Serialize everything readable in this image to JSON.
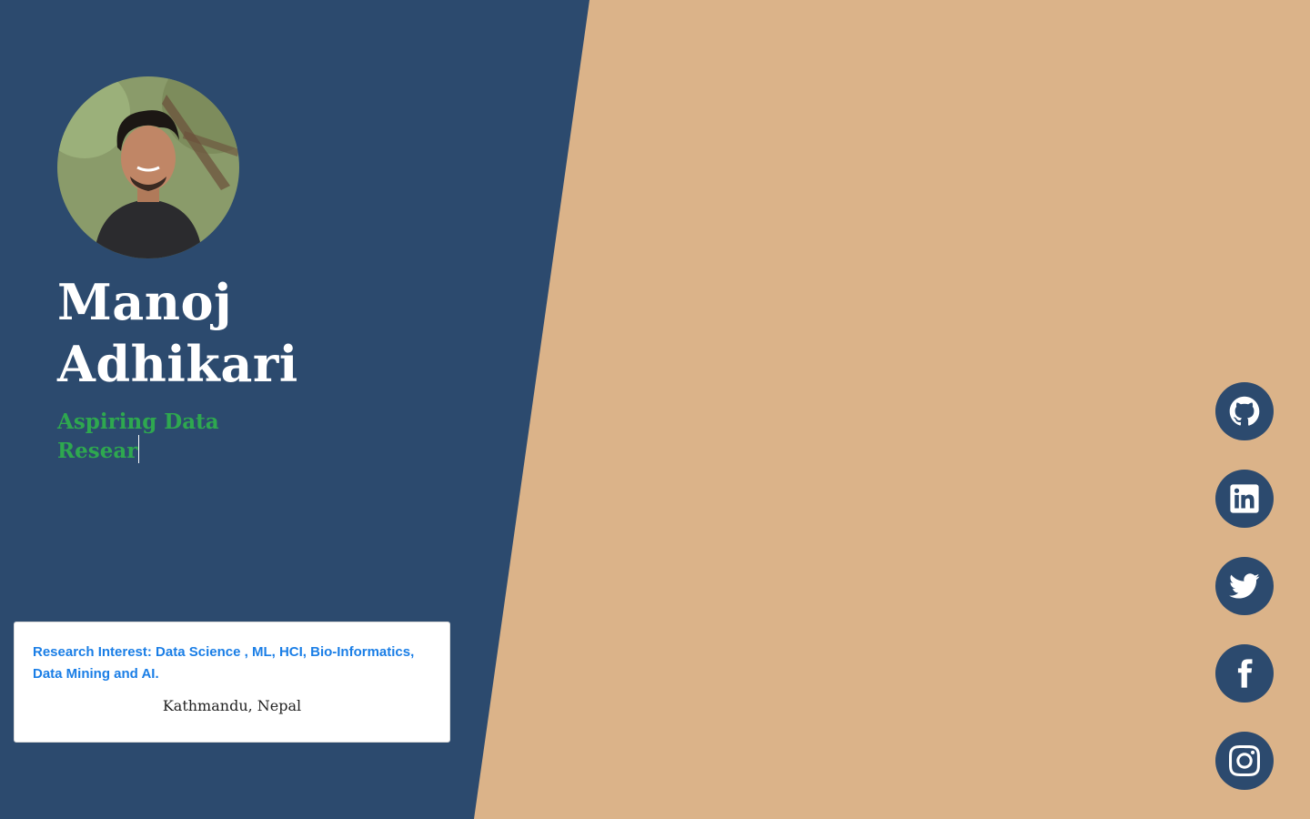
{
  "profile": {
    "first_name": "Manoj",
    "last_name": "Adhikari",
    "tagline": "Aspiring Data Resear",
    "avatar": "profile-photo"
  },
  "card": {
    "research_interest": "Research Interest: Data Science , ML, HCI, Bio-Informatics, Data Mining and AI.",
    "location": "Kathmandu, Nepal"
  },
  "social": [
    {
      "name": "github",
      "icon": "github-icon"
    },
    {
      "name": "linkedin",
      "icon": "linkedin-icon"
    },
    {
      "name": "twitter",
      "icon": "twitter-icon"
    },
    {
      "name": "facebook",
      "icon": "facebook-icon"
    },
    {
      "name": "instagram",
      "icon": "instagram-icon"
    }
  ],
  "colors": {
    "panel": "#2c4a6e",
    "background": "#dbb389",
    "accent_green": "#2ea84f",
    "link_blue": "#1a7ee6",
    "icon_bg": "#2c4a6e"
  }
}
